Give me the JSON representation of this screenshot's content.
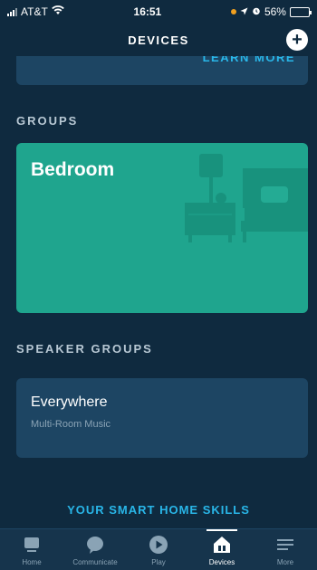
{
  "status": {
    "carrier": "AT&T",
    "time": "16:51",
    "battery": "56%",
    "battery_level": 0.56
  },
  "header": {
    "title": "DEVICES",
    "add_glyph": "+"
  },
  "top_card": {
    "link": "LEARN MORE"
  },
  "groups": {
    "label": "GROUPS",
    "items": [
      {
        "name": "Bedroom",
        "color": "#1fa58e"
      }
    ]
  },
  "speaker_groups": {
    "label": "SPEAKER GROUPS",
    "items": [
      {
        "name": "Everywhere",
        "subtitle": "Multi-Room Music"
      }
    ]
  },
  "skills_link": "YOUR SMART HOME SKILLS",
  "tabs": [
    {
      "label": "Home",
      "icon": "home-icon",
      "active": false
    },
    {
      "label": "Communicate",
      "icon": "chat-bubble-icon",
      "active": false
    },
    {
      "label": "Play",
      "icon": "play-icon",
      "active": false
    },
    {
      "label": "Devices",
      "icon": "devices-house-icon",
      "active": true
    },
    {
      "label": "More",
      "icon": "menu-lines-icon",
      "active": false
    }
  ],
  "colors": {
    "background": "#0f2a3f",
    "card": "#1d4563",
    "accent": "#29b6e8",
    "group_teal": "#1fa58e"
  }
}
